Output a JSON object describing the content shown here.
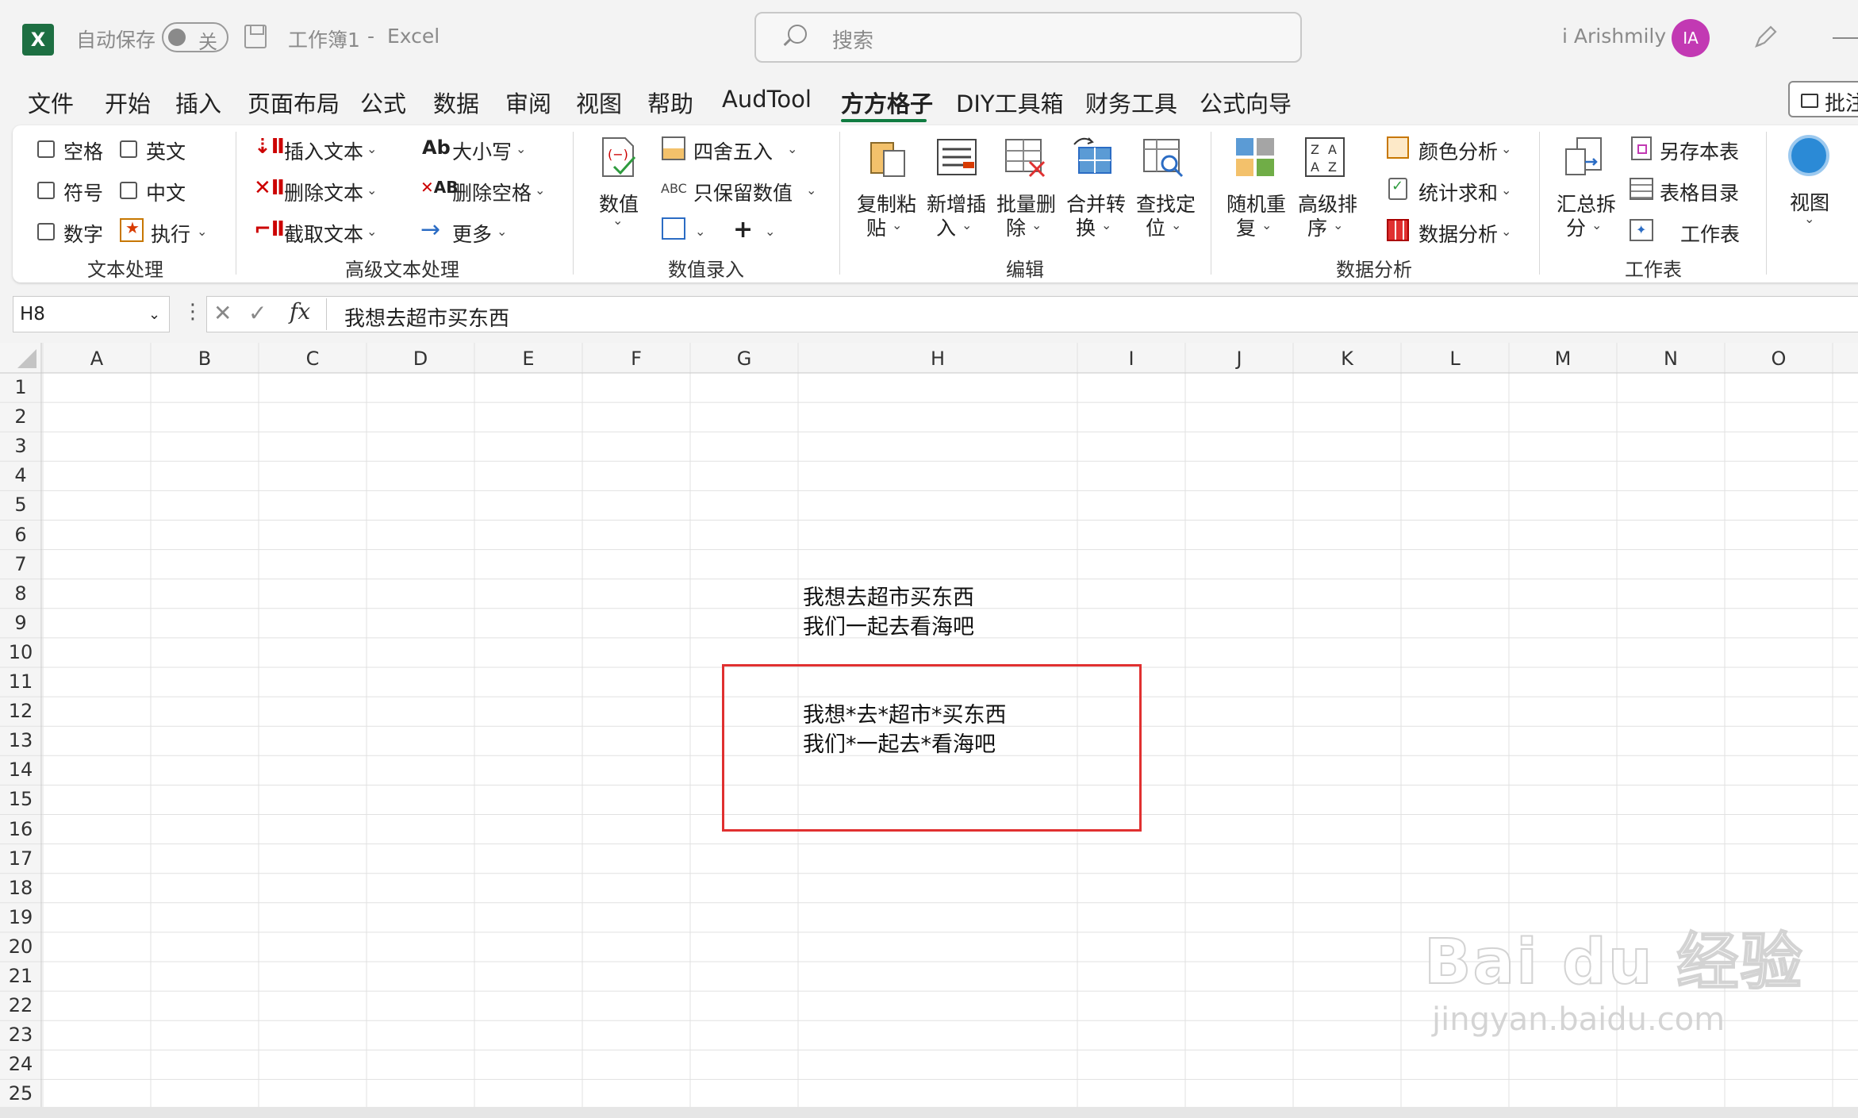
{
  "titlebar": {
    "autosave_label": "自动保存",
    "autosave_state": "关",
    "workbook": "工作簿1",
    "separator": "-",
    "app": "Excel",
    "search_placeholder": "搜索",
    "user_name": "i Arishmily",
    "avatar_initials": "IA"
  },
  "menu": {
    "tabs": [
      "文件",
      "开始",
      "插入",
      "页面布局",
      "公式",
      "数据",
      "审阅",
      "视图",
      "帮助",
      "AudTool",
      "方方格子",
      "DIY工具箱",
      "财务工具",
      "公式向导"
    ],
    "active_tab": "方方格子",
    "notes_button": "批注"
  },
  "ribbon": {
    "text_processing": {
      "checkboxes": [
        "空格",
        "英文",
        "符号",
        "中文",
        "数字"
      ],
      "execute": "执行",
      "group_label": "文本处理"
    },
    "advanced_text": {
      "insert_text": "插入文本",
      "delete_text": "删除文本",
      "extract_text": "截取文本",
      "case": "大小写",
      "delete_spaces": "删除空格",
      "more": "更多",
      "group_label": "高级文本处理"
    },
    "numeric_entry": {
      "value": "数值",
      "round": "四舍五入",
      "keep_numbers": "只保留数值",
      "group_label": "数值录入"
    },
    "edit": {
      "buttons": [
        {
          "line1": "复制粘",
          "line2": "贴"
        },
        {
          "line1": "新增插",
          "line2": "入"
        },
        {
          "line1": "批量删",
          "line2": "除"
        },
        {
          "line1": "合并转",
          "line2": "换"
        },
        {
          "line1": "查找定",
          "line2": "位"
        }
      ],
      "group_label": "编辑"
    },
    "data_analysis": {
      "random": {
        "line1": "随机重",
        "line2": "复"
      },
      "sort": {
        "line1": "高级排",
        "line2": "序"
      },
      "color_analysis": "颜色分析",
      "stats_sum": "统计求和",
      "data_analysis": "数据分析",
      "group_label": "数据分析"
    },
    "worksheet": {
      "summary_split": {
        "line1": "汇总拆",
        "line2": "分"
      },
      "save_sheet": "另存本表",
      "table_toc": "表格目录",
      "worksheet": "工作表",
      "group_label": "工作表"
    },
    "view": {
      "label": "视图"
    }
  },
  "formula_bar": {
    "name_box": "H8",
    "fx": "fx",
    "content": "我想去超市买东西"
  },
  "grid": {
    "columns": [
      "A",
      "B",
      "C",
      "D",
      "E",
      "F",
      "G",
      "H",
      "I",
      "J",
      "K",
      "L",
      "M",
      "N",
      "O"
    ],
    "rows": [
      "1",
      "2",
      "3",
      "4",
      "5",
      "6",
      "7",
      "8",
      "9",
      "10",
      "11",
      "12",
      "13",
      "14",
      "15",
      "16",
      "17",
      "18",
      "19",
      "20",
      "21",
      "22",
      "23",
      "24",
      "25"
    ],
    "cells": {
      "H8": "我想去超市买东西",
      "H9": "我们一起去看海吧",
      "H12": "我想*去*超市*买东西",
      "H13": "我们*一起去*看海吧"
    }
  },
  "watermark": {
    "brand_line1": "Bai du 经验",
    "brand_line2": "jingyan.baidu.com"
  },
  "colors": {
    "excel_green": "#1d6f42",
    "avatar": "#c239b3",
    "highlight": "#e03030"
  }
}
